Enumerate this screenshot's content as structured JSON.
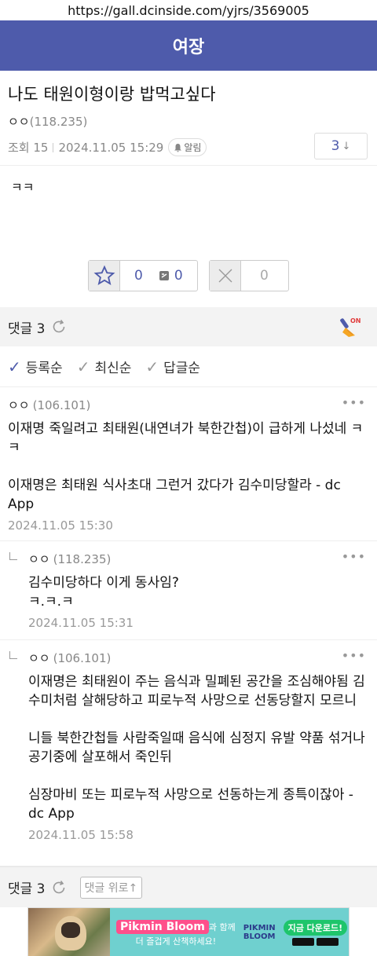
{
  "url": "https://gall.dcinside.com/yjrs/3569005",
  "gallery_name": "여장",
  "post": {
    "title": "나도 태원이형이랑 밥먹고싶다",
    "author": "ㅇㅇ",
    "author_ip": "(118.235)",
    "views": "조회 15",
    "date": "2024.11.05 15:29",
    "alarm_label": "알림",
    "comment_count": "3",
    "body": "ㅋㅋ"
  },
  "votes": {
    "up": "0",
    "fixed_up": "0",
    "down": "0"
  },
  "comments_header": {
    "label": "댓글 3",
    "brush_label": "ON"
  },
  "sort": [
    "등록순",
    "최신순",
    "답글순"
  ],
  "comments": [
    {
      "author": "ㅇㅇ",
      "ip": "(106.101)",
      "text": "이재명 죽일려고 최태원(내연녀가 북한간첩)이 급하게 나섰네 ㅋㅋ\n\n이재명은 최태원 식사초대 그런거 갔다가 김수미당할라 - dc App",
      "date": "2024.11.05 15:30"
    },
    {
      "author": "ㅇㅇ",
      "ip": "(118.235)",
      "text": "김수미당하다 이게 동사임?\nㅋ.ㅋ.ㅋ",
      "date": "2024.11.05 15:31"
    },
    {
      "author": "ㅇㅇ",
      "ip": "(106.101)",
      "text": "이재명은 최태원이 주는 음식과 밀폐된 공간을 조심해야됨 김수미처럼 살해당하고 피로누적 사망으로 선동당할지 모르니\n\n니들 북한간첩들 사람죽일때 음식에 심정지 유발 약품 섞거나 공기중에 살포해서 죽인뒤\n\n심장마비 또는 피로누적 사망으로 선동하는게 종특이잖아 - dc App",
      "date": "2024.11.05 15:58"
    }
  ],
  "footer": {
    "label": "댓글 3",
    "to_top": "댓글 위로↑"
  },
  "ad": {
    "brand": "Pikmin Bloom",
    "brand_tail": "과 함께",
    "sub": "더 즐겁게 산책하세요!",
    "logo_line1": "PIKMIN",
    "logo_line2": "BLOOM",
    "cta": "지금 다운로드!"
  }
}
